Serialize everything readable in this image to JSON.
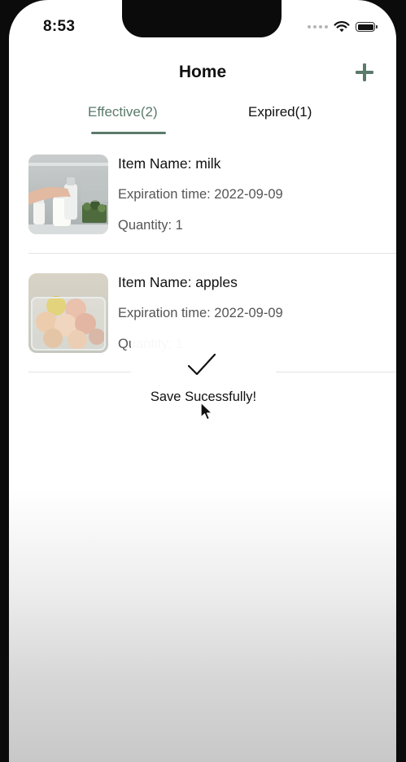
{
  "status_bar": {
    "time": "8:53"
  },
  "nav": {
    "title": "Home",
    "add_icon": "plus-icon",
    "accent_color": "#5b7a6b"
  },
  "tabs": [
    {
      "label": "Effective(2)",
      "active": true
    },
    {
      "label": "Expired(1)",
      "active": false
    }
  ],
  "items": [
    {
      "name": "Item Name: milk",
      "expiration": "Expiration time: 2022-09-09",
      "quantity": "Quantity: 1",
      "image": "milk-photo"
    },
    {
      "name": "Item Name: apples",
      "expiration": "Expiration time: 2022-09-09",
      "quantity": "Quantity: 1",
      "image": "apples-photo"
    }
  ],
  "toast": {
    "icon": "checkmark-icon",
    "message": "Save Sucessfully!"
  }
}
